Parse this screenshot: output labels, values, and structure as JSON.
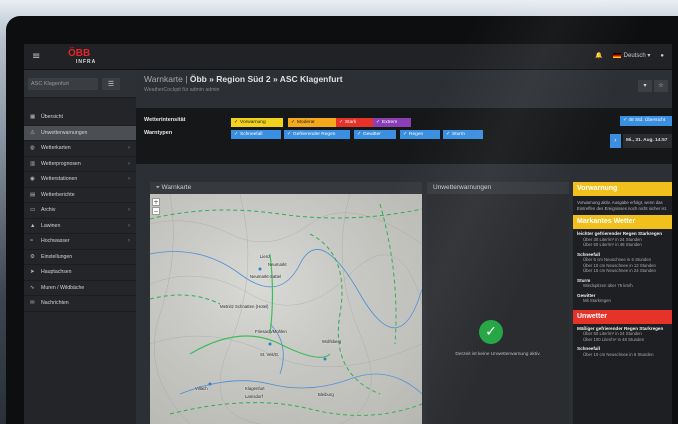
{
  "app": {
    "logo": "ÖBB",
    "logo_sub": "INFRA",
    "language": "Deutsch"
  },
  "sidebar": {
    "search_placeholder": "ASC Klagenfurt",
    "items": [
      {
        "label": "Übersicht",
        "icon": "grid-icon",
        "arrow": ""
      },
      {
        "label": "Unwetterwarnungen",
        "icon": "warning-icon",
        "arrow": ""
      },
      {
        "label": "Wetterkarten",
        "icon": "globe-icon",
        "arrow": "›"
      },
      {
        "label": "Wetterprognosen",
        "icon": "chart-icon",
        "arrow": "›"
      },
      {
        "label": "Wetterstationen",
        "icon": "station-icon",
        "arrow": "›"
      },
      {
        "label": "Wetterberichte",
        "icon": "document-icon",
        "arrow": ""
      },
      {
        "label": "Archiv",
        "icon": "folder-icon",
        "arrow": "›"
      },
      {
        "label": "Lawinen",
        "icon": "avalanche-icon",
        "arrow": "›"
      },
      {
        "label": "Hochwasser",
        "icon": "flood-icon",
        "arrow": "›"
      },
      {
        "label": "Einstellungen",
        "icon": "gear-icon",
        "arrow": ""
      },
      {
        "label": "Hauptachsen",
        "icon": "route-icon",
        "arrow": ""
      },
      {
        "label": "Muren / Wildbäche",
        "icon": "river-icon",
        "arrow": ""
      },
      {
        "label": "Nachrichten",
        "icon": "message-icon",
        "arrow": ""
      }
    ]
  },
  "header": {
    "prefix": "Warnkarte | ",
    "title": "Öbb » Region Süd 2 » ASC Klagenfurt",
    "subtitle": "WeatherCockpit für admin admin"
  },
  "filters": {
    "intensity_label": "Wetterintensität",
    "types_label": "Warntypen",
    "intensity": [
      {
        "label": "Vorwarnung",
        "color": "#f2d21c",
        "text": "#222"
      },
      {
        "label": "Moderat",
        "color": "#f4a81c",
        "text": "#222"
      },
      {
        "label": "Stark",
        "color": "#e6332a",
        "text": "#fff"
      },
      {
        "label": "Extrem",
        "color": "#8a3fb5",
        "text": "#fff"
      }
    ],
    "types": [
      {
        "label": "Schneefall"
      },
      {
        "label": "Gefrierender Regen"
      },
      {
        "label": "Gewitter"
      },
      {
        "label": "Regen"
      },
      {
        "label": "Sturm"
      }
    ],
    "types_color": "#3a8fe0",
    "overview_btn": "48 Std. Übersicht",
    "date": "Mi., 31. Aug. 14:57"
  },
  "map": {
    "title": "Warnkarte",
    "places": [
      "Lienz",
      "Neumarkt",
      "Neumarkt-Sattel",
      "Metnitz Schnatten (Hotel)",
      "Friesach/Mühlen",
      "St. Veit/G.",
      "Wolfsberg",
      "Villach",
      "Klagenfurt",
      "Lamsdorf",
      "Bleiburg"
    ]
  },
  "unwetter": {
    "title": "Unwetterwarnungen",
    "message": "Derzeit ist keine Unwetterwarnung aktiv."
  },
  "warnings": {
    "vorwarnung": {
      "title": "Vorwarnung",
      "color": "#f2c01c",
      "text": "Vorwarnung aktiv. Ausgabe erfolgt, wenn das Eintreffen des Ereignisses noch nicht sicher ist."
    },
    "markant": {
      "title": "Markantes Wetter",
      "color": "#f2c01c",
      "sections": [
        {
          "h": "leichter gefrierender Regen Starkregen",
          "lines": [
            "Über 30 Liter/m² in 24 Stunden",
            "Über 60 Liter/m² in 48 Stunden"
          ]
        },
        {
          "h": "Schneefall",
          "lines": [
            "Über 5 cm Neuschnee in 6 Stunden",
            "Über 10 cm Neuschnee in 12 Stunden",
            "Über 15 cm Neuschnee in 24 Stunden"
          ]
        },
        {
          "h": "Sturm",
          "lines": [
            "Windspitzen über 75 km/h"
          ]
        },
        {
          "h": "Gewitter",
          "lines": [
            "Mit Starkregen"
          ]
        }
      ]
    },
    "unwetter": {
      "title": "Unwetter",
      "color": "#e6332a",
      "sections": [
        {
          "h": "Mäßiger gefrierender Regen Starkregen",
          "lines": [
            "Über 50 Liter/m² in 24 Stunden",
            "Über 100 Liter/m² in 48 Stunden"
          ]
        },
        {
          "h": "Schneefall",
          "lines": [
            "Über 10 cm Neuschnee in 6 Stunden"
          ]
        }
      ]
    }
  }
}
